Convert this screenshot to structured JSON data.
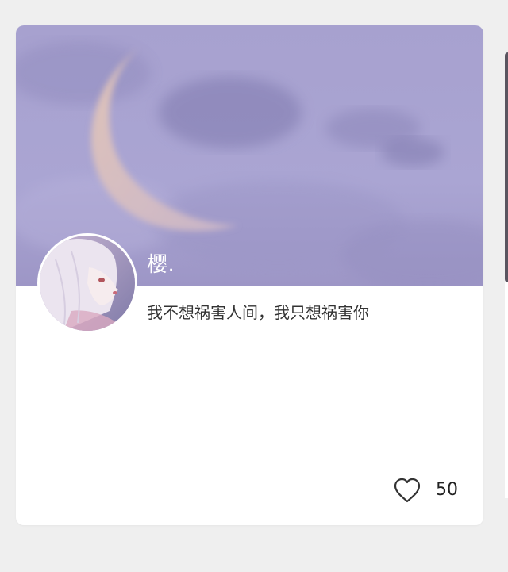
{
  "card": {
    "username": "樱.",
    "bio": "我不想祸害人间，我只想祸害你",
    "likes": "50"
  },
  "icons": {
    "like": "heart-outline-icon"
  },
  "colors": {
    "page_background": "#efefef",
    "card_background": "#ffffff",
    "cover_sky": "#a9a4d0",
    "text_primary": "#333333"
  }
}
